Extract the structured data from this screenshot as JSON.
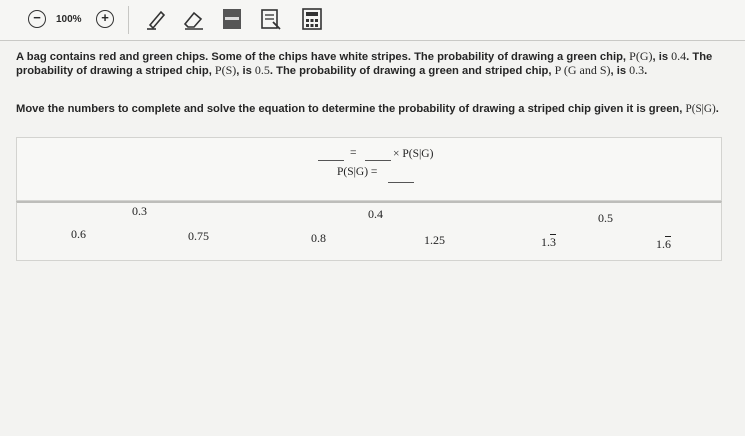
{
  "toolbar": {
    "zoom_out_label": "−",
    "zoom_level": "100%",
    "zoom_in_label": "+"
  },
  "problem": {
    "line1_a": "A bag contains red and green chips. Some of the chips have white stripes. The probability of drawing a green chip, ",
    "pg": "P(G)",
    "line1_b": ", is ",
    "pg_val": "0.4",
    "line1_c": ". The",
    "line2_a": "probability of drawing a striped chip, ",
    "ps": "P(S)",
    "line2_b": ", is ",
    "ps_val": "0.5",
    "line2_c": ". The probability of drawing a green and striped chip, ",
    "pgs": "P (G and S)",
    "line2_d": ", is ",
    "pgs_val": "0.3",
    "line2_e": "."
  },
  "instruction": {
    "text": "Move the numbers to complete and solve the equation to determine the probability of drawing a striped chip given it is green, ",
    "math": "P(S|G)",
    "end": "."
  },
  "equation": {
    "equals": "=",
    "times_psg": "× P(S|G)",
    "psg_label": "P(S|G) ="
  },
  "tiles": {
    "t03": "0.3",
    "t04": "0.4",
    "t05": "0.5",
    "t06": "0.6",
    "t075": "0.75",
    "t08": "0.8",
    "t125": "1.25",
    "t13_int": "1.",
    "t13_rep": "3",
    "t16_int": "1.",
    "t16_rep": "6"
  }
}
